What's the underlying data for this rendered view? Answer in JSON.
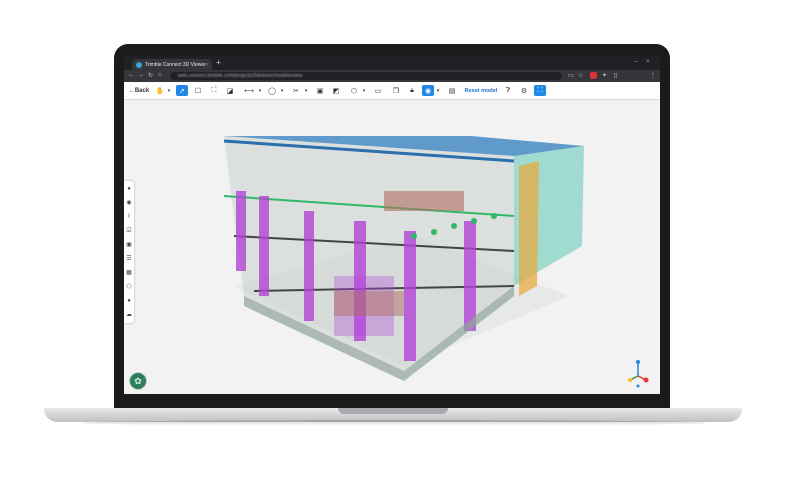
{
  "browser": {
    "tab_title": "Trimble Connect 3D Viewer",
    "new_tab": "+",
    "url": "web.connect.trimble.com/projects/3dviewer/models/view"
  },
  "toolbar": {
    "back_label": "Back",
    "reset_label": "Reset model"
  },
  "icons": {
    "back": "arrow-left-icon",
    "pan": "hand-icon",
    "select": "pointer-icon",
    "section": "section-box-icon",
    "measure": "measure-icon",
    "markup": "markup-icon",
    "view": "eye-icon",
    "settings": "gear-icon",
    "help": "help-icon"
  },
  "colors": {
    "accent": "#1e88e5",
    "structure": "#b244d6",
    "steel": "#2c6fae",
    "pipes": "#2fb86a",
    "facade": "#5ec9b5",
    "avatar": "#2e7d5b"
  }
}
